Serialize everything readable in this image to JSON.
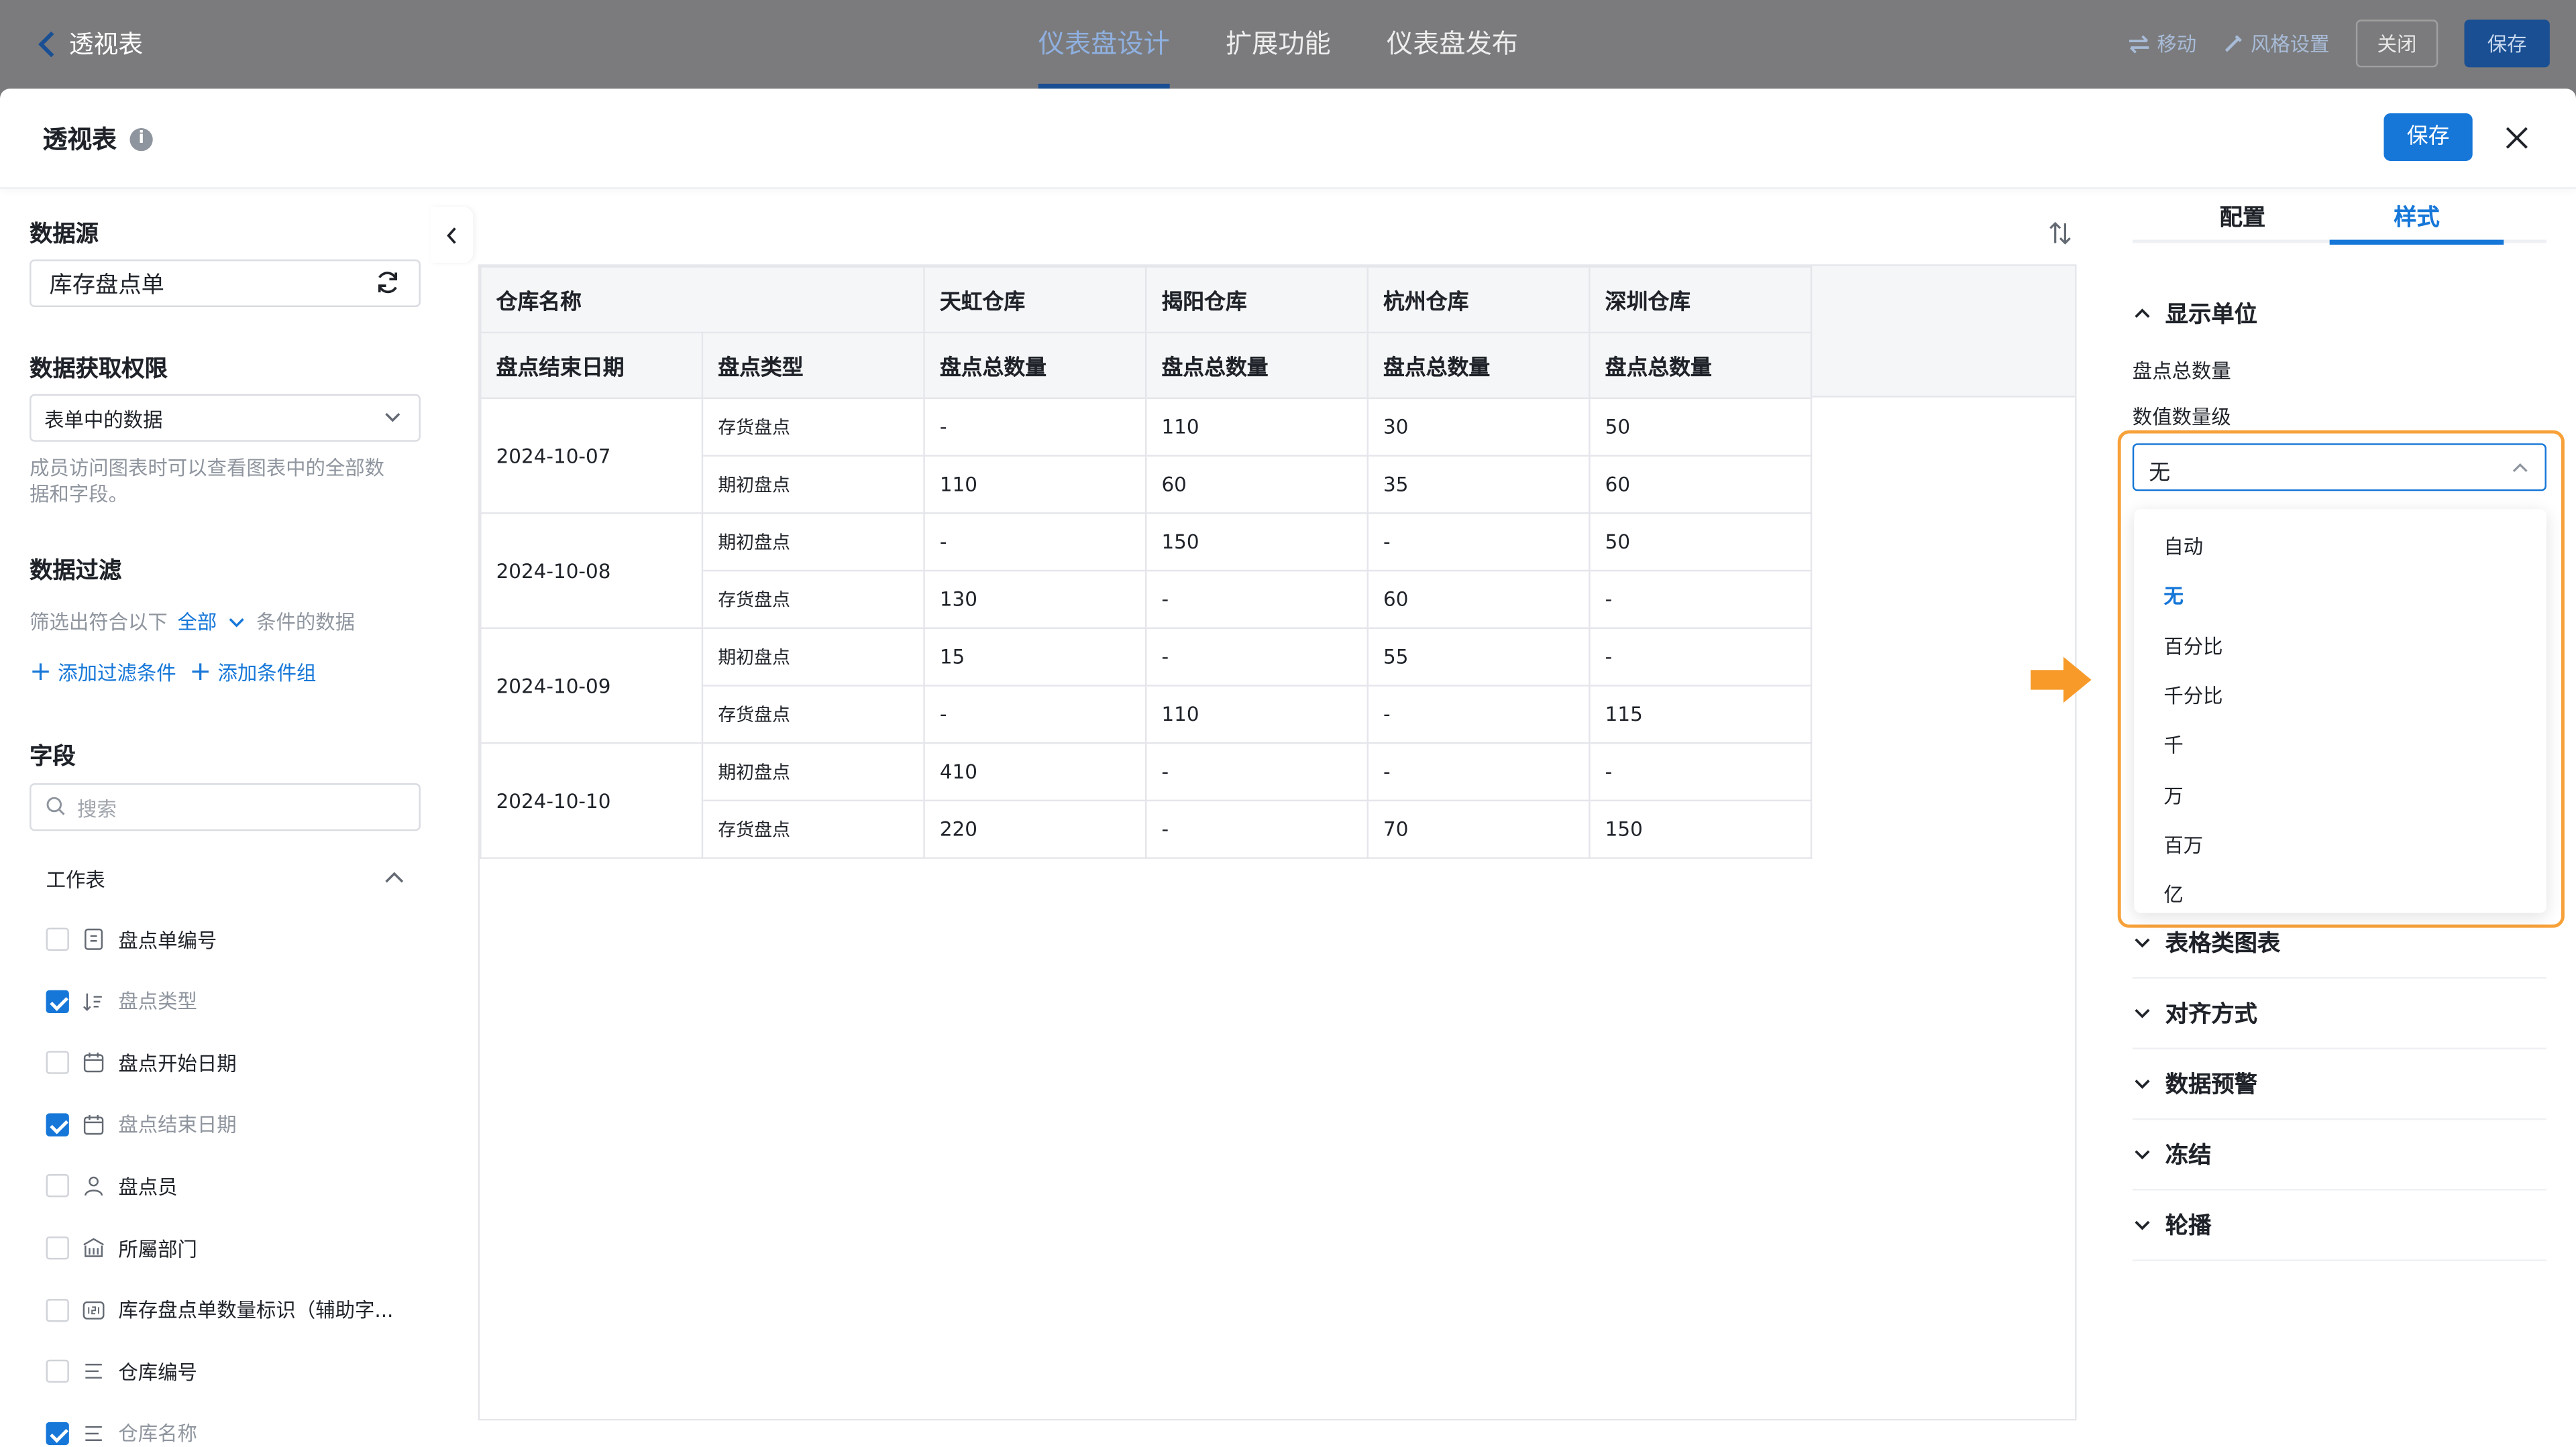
{
  "topbar": {
    "back_label": "透视表",
    "tabs": [
      "仪表盘设计",
      "扩展功能",
      "仪表盘发布"
    ],
    "move_label": "移动",
    "style_settings_label": "风格设置",
    "close_label": "关闭",
    "save_label": "保存"
  },
  "modal": {
    "title": "透视表",
    "save_label": "保存"
  },
  "left_panel": {
    "datasource_heading": "数据源",
    "datasource_value": "库存盘点单",
    "permission_heading": "数据获取权限",
    "permission_value": "表单中的数据",
    "permission_hint_line1": "成员访问图表时可以查看图表中的全部数",
    "permission_hint_line2": "据和字段。",
    "filter_heading": "数据过滤",
    "filter_prefix": "筛选出符合以下",
    "filter_scope": "全部",
    "filter_suffix": "条件的数据",
    "add_filter_label": "添加过滤条件",
    "add_group_label": "添加条件组",
    "fields_heading": "字段",
    "search_placeholder": "搜索",
    "worksheet_label": "工作表",
    "fields": [
      {
        "label": "盘点单编号",
        "checked": false,
        "icon": "doc-icon"
      },
      {
        "label": "盘点类型",
        "checked": true,
        "icon": "sort-list-icon"
      },
      {
        "label": "盘点开始日期",
        "checked": false,
        "icon": "calendar-icon"
      },
      {
        "label": "盘点结束日期",
        "checked": true,
        "icon": "calendar-icon"
      },
      {
        "label": "盘点员",
        "checked": false,
        "icon": "user-icon"
      },
      {
        "label": "所屬部门",
        "checked": false,
        "icon": "building-icon"
      },
      {
        "label": "库存盘点单数量标识（辅助字...",
        "checked": false,
        "icon": "number-icon"
      },
      {
        "label": "仓库编号",
        "checked": false,
        "icon": "text-lines-icon"
      },
      {
        "label": "仓库名称",
        "checked": true,
        "icon": "text-lines-icon"
      }
    ]
  },
  "pivot": {
    "corner_header": "仓库名称",
    "row_headers": [
      "盘点结束日期",
      "盘点类型"
    ],
    "warehouses": [
      "天虹仓库",
      "揭阳仓库",
      "杭州仓库",
      "深圳仓库"
    ],
    "measure_label": "盘点总数量",
    "groups": [
      {
        "date": "2024-10-07",
        "rows": [
          {
            "type": "存货盘点",
            "values": [
              "-",
              "110",
              "30",
              "50"
            ]
          },
          {
            "type": "期初盘点",
            "values": [
              "110",
              "60",
              "35",
              "60"
            ]
          }
        ]
      },
      {
        "date": "2024-10-08",
        "rows": [
          {
            "type": "期初盘点",
            "values": [
              "-",
              "150",
              "-",
              "50"
            ]
          },
          {
            "type": "存货盘点",
            "values": [
              "130",
              "-",
              "60",
              "-"
            ]
          }
        ]
      },
      {
        "date": "2024-10-09",
        "rows": [
          {
            "type": "期初盘点",
            "values": [
              "15",
              "-",
              "55",
              "-"
            ]
          },
          {
            "type": "存货盘点",
            "values": [
              "-",
              "110",
              "-",
              "115"
            ]
          }
        ]
      },
      {
        "date": "2024-10-10",
        "rows": [
          {
            "type": "期初盘点",
            "values": [
              "410",
              "-",
              "-",
              "-"
            ]
          },
          {
            "type": "存货盘点",
            "values": [
              "220",
              "-",
              "70",
              "150"
            ]
          }
        ]
      }
    ]
  },
  "right_panel": {
    "tabs": [
      "配置",
      "样式"
    ],
    "active_tab": "样式",
    "display_unit_heading": "显示单位",
    "measure_label": "盘点总数量",
    "magnitude_label": "数值数量级",
    "selected_value": "无",
    "options": [
      "自动",
      "无",
      "百分比",
      "千分比",
      "千",
      "万",
      "百万",
      "亿"
    ],
    "sections": [
      "表格类图表",
      "对齐方式",
      "数据预警",
      "冻结",
      "轮播"
    ]
  },
  "colors": {
    "accent": "#1677d8",
    "highlight": "#f7a13a",
    "overlay": "#7b7b7d"
  }
}
